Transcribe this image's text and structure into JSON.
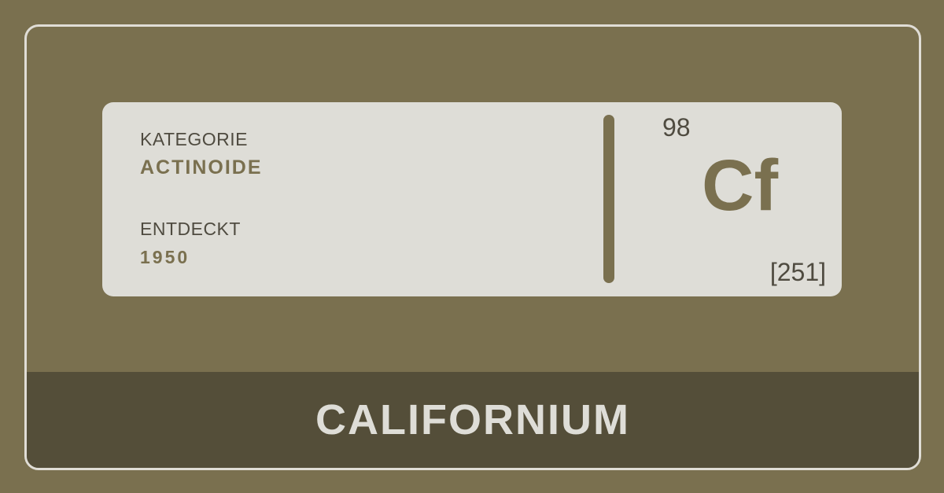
{
  "colors": {
    "background": "#7a704f",
    "card": "#deddd7",
    "banner": "#544e39",
    "accent": "#7a704f",
    "text_dark": "#4f4b40",
    "frame_border": "#e0ddd6"
  },
  "details": {
    "category_label": "KATEGORIE",
    "category_value": "ACTINOIDE",
    "discovered_label": "ENTDECKT",
    "discovered_value": "1950"
  },
  "element": {
    "atomic_number": "98",
    "symbol": "Cf",
    "atomic_mass": "[251]",
    "name": "CALIFORNIUM"
  }
}
